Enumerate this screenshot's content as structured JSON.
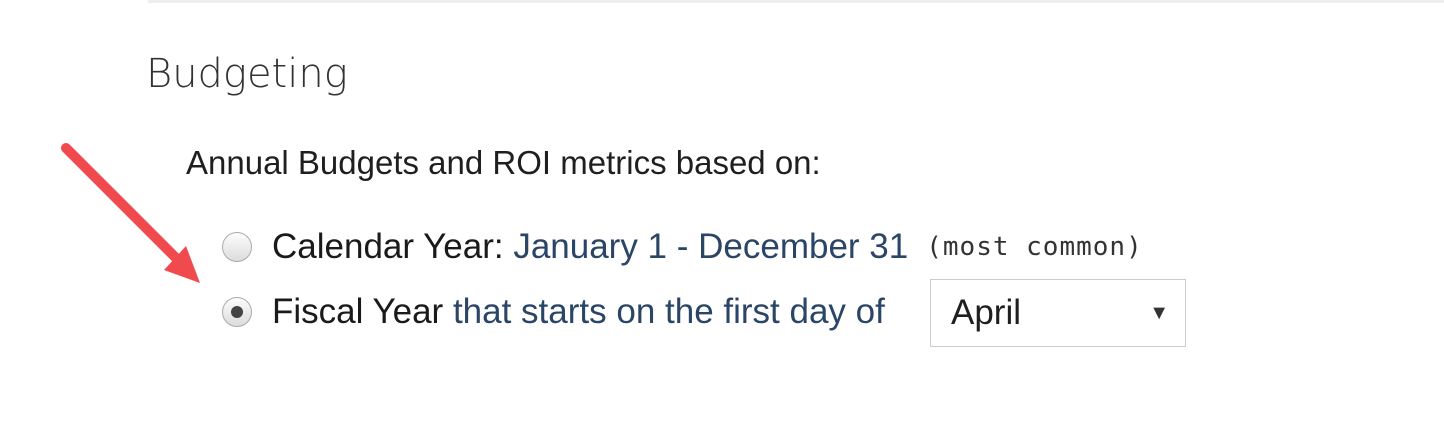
{
  "section": {
    "title": "Budgeting"
  },
  "prompt": "Annual Budgets and ROI metrics based on:",
  "options": {
    "calendar": {
      "label": "Calendar Year",
      "colon": ":",
      "detail": "January 1 - December 31",
      "note": "(most common)",
      "selected": false
    },
    "fiscal": {
      "label": "Fiscal Year",
      "detail": "that starts on the first day of",
      "selected": true
    }
  },
  "month_select": {
    "value": "April",
    "caret": "▼"
  },
  "colors": {
    "arrow": "#f04a4f",
    "detail_text": "#2b4566"
  },
  "icons": {
    "annotation": "arrow-icon",
    "dropdown": "chevron-down-icon"
  }
}
